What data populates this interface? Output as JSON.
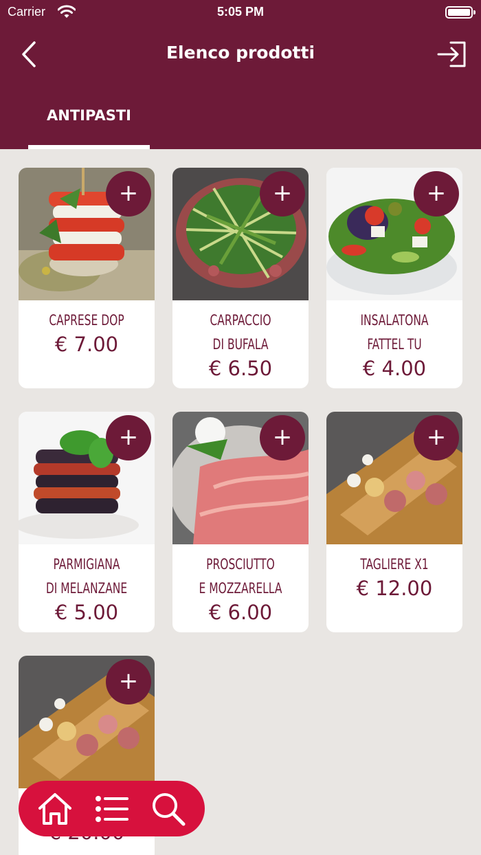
{
  "status_bar": {
    "carrier": "Carrier",
    "time": "5:05 PM"
  },
  "nav": {
    "title": "Elenco prodotti"
  },
  "tabs": [
    {
      "label": "ANTIPASTI"
    }
  ],
  "products": [
    {
      "name_line1": "CAPRESE DOP",
      "name_line2": "",
      "price": "€ 7.00"
    },
    {
      "name_line1": "CARPACCIO",
      "name_line2": "DI BUFALA",
      "price": "€ 6.50"
    },
    {
      "name_line1": "INSALATONA",
      "name_line2": "FATTEL TU",
      "price": "€ 4.00"
    },
    {
      "name_line1": "PARMIGIANA",
      "name_line2": "DI MELANZANE",
      "price": "€ 5.00"
    },
    {
      "name_line1": "PROSCIUTTO",
      "name_line2": "E MOZZARELLA",
      "price": "€ 6.00"
    },
    {
      "name_line1": "TAGLIERE X1",
      "name_line2": "",
      "price": "€ 12.00"
    },
    {
      "name_line1": "",
      "name_line2": "",
      "price": "€ 20.00"
    }
  ],
  "add_label": "+",
  "bottom_nav": [
    "home-icon",
    "list-icon",
    "search-icon"
  ],
  "colors": {
    "brand": "#6d1a38",
    "accent": "#d7113d",
    "background": "#e9e6e3"
  }
}
